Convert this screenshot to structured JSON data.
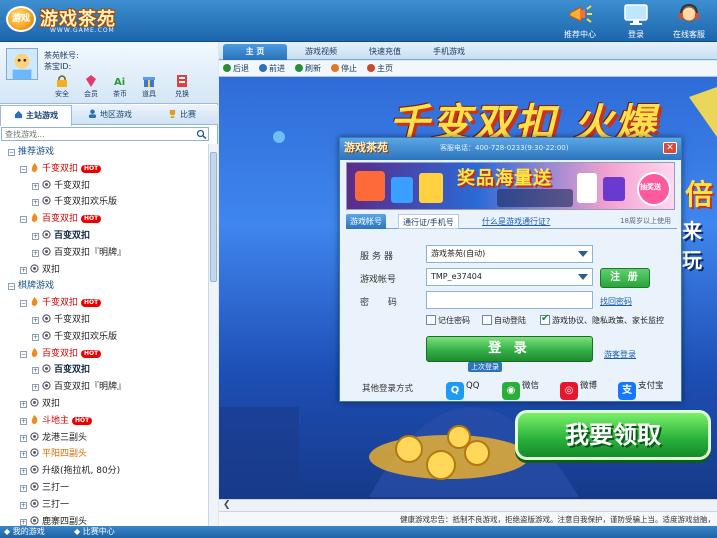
{
  "app": {
    "logo_badge": "游戏",
    "logo_text": "游戏茶苑",
    "logo_url": "WWW.GAME.COM",
    "top_nav": [
      {
        "label": "推荐中心",
        "icon": "megaphone-icon"
      },
      {
        "label": "登录",
        "icon": "monitor-icon"
      },
      {
        "label": "在线客服",
        "icon": "headset-icon"
      }
    ]
  },
  "user": {
    "account_label": "茶苑帐号:",
    "id_label": "茶宝ID:",
    "quick_actions": [
      {
        "label": "安全",
        "icon": "lock-icon"
      },
      {
        "label": "会员",
        "icon": "diamond-icon"
      },
      {
        "label": "茶币",
        "icon": "coin-icon"
      },
      {
        "label": "道具",
        "icon": "gift-icon"
      },
      {
        "label": "兑换",
        "icon": "exchange-icon"
      }
    ]
  },
  "left_tabs": [
    {
      "label": "主站游戏",
      "icon": "home-icon"
    },
    {
      "label": "地区游戏",
      "icon": "people-icon"
    },
    {
      "label": "比赛",
      "icon": "trophy-icon"
    }
  ],
  "search": {
    "placeholder": "查找游戏..."
  },
  "tree": [
    {
      "level": 0,
      "exp": "⊟",
      "text": "推荐游戏",
      "style": "blue",
      "icon": "none"
    },
    {
      "level": 1,
      "exp": "⊟",
      "text": "千变双扣",
      "style": "red",
      "icon": "fire-icon",
      "hot": "HOT"
    },
    {
      "level": 2,
      "exp": "⊞",
      "text": "千变双扣",
      "style": "",
      "icon": "game-icon"
    },
    {
      "level": 2,
      "exp": "⊞",
      "text": "千变双扣欢乐版",
      "style": "",
      "icon": "game-icon"
    },
    {
      "level": 1,
      "exp": "⊟",
      "text": "百变双扣",
      "style": "red",
      "icon": "fire-icon",
      "hot": "HOT"
    },
    {
      "level": 2,
      "exp": "⊞",
      "text": "百变双扣",
      "style": "bold",
      "icon": "game-icon"
    },
    {
      "level": 2,
      "exp": "⊞",
      "text": "百变双扣『明牌』",
      "style": "",
      "icon": "game-icon"
    },
    {
      "level": 1,
      "exp": "⊞",
      "text": "双扣",
      "style": "",
      "icon": "game-icon"
    },
    {
      "level": 0,
      "exp": "⊟",
      "text": "棋牌游戏",
      "style": "blue",
      "icon": "none"
    },
    {
      "level": 1,
      "exp": "⊟",
      "text": "千变双扣",
      "style": "red",
      "icon": "fire-icon",
      "hot": "HOT"
    },
    {
      "level": 2,
      "exp": "⊞",
      "text": "千变双扣",
      "style": "",
      "icon": "game-icon"
    },
    {
      "level": 2,
      "exp": "⊞",
      "text": "千变双扣欢乐版",
      "style": "",
      "icon": "game-icon"
    },
    {
      "level": 1,
      "exp": "⊟",
      "text": "百变双扣",
      "style": "red",
      "icon": "fire-icon",
      "hot": "HOT"
    },
    {
      "level": 2,
      "exp": "⊞",
      "text": "百变双扣",
      "style": "bold",
      "icon": "game-icon"
    },
    {
      "level": 2,
      "exp": "⊞",
      "text": "百变双扣『明牌』",
      "style": "",
      "icon": "game-icon"
    },
    {
      "level": 1,
      "exp": "⊞",
      "text": "双扣",
      "style": "",
      "icon": "game-icon"
    },
    {
      "level": 1,
      "exp": "⊞",
      "text": "斗地主",
      "style": "red",
      "icon": "fire-icon",
      "hot": "HOT"
    },
    {
      "level": 1,
      "exp": "⊞",
      "text": "龙港三副头",
      "style": "",
      "icon": "game-icon"
    },
    {
      "level": 1,
      "exp": "⊞",
      "text": "平阳四副头",
      "style": "orange",
      "icon": "game-icon"
    },
    {
      "level": 1,
      "exp": "⊞",
      "text": "升级(拖拉机, 80分)",
      "style": "",
      "icon": "game-icon"
    },
    {
      "level": 1,
      "exp": "⊞",
      "text": "三打一",
      "style": "",
      "icon": "game-icon"
    },
    {
      "level": 1,
      "exp": "⊞",
      "text": "三打一",
      "style": "",
      "icon": "game-icon"
    },
    {
      "level": 1,
      "exp": "⊞",
      "text": "鹿寨四副头",
      "style": "",
      "icon": "game-icon"
    }
  ],
  "bottom_tabs": [
    "我的游戏",
    "比赛中心"
  ],
  "right_tabs": [
    "主 页",
    "游戏视频",
    "快速充值",
    "手机游戏"
  ],
  "nav_buttons": [
    {
      "label": "后退",
      "icon": "back-icon",
      "color": "#2e8b3a"
    },
    {
      "label": "前进",
      "icon": "forward-icon",
      "color": "#2e6fc0"
    },
    {
      "label": "刷新",
      "icon": "refresh-icon",
      "color": "#2e8b3a"
    },
    {
      "label": "停止",
      "icon": "stop-icon",
      "color": "#e07820"
    },
    {
      "label": "主页",
      "icon": "home-icon",
      "color": "#c84a2a"
    }
  ],
  "promo": {
    "headline": "千变双扣 火爆",
    "side_char": "倍",
    "side_text": "来玩",
    "claim_button": "我要领取"
  },
  "footer_notice": "健康游戏忠告：抵制不良游戏，拒绝盗版游戏。注意自我保护，谨防受骗上当。适度游戏益脑，",
  "dialog": {
    "logo": "游戏茶苑",
    "phone": "客服电话：400-728-0233(9:30-22:00)",
    "banner_title": "奖品海量送",
    "banner_badge": "抽奖送",
    "tabs": [
      "游戏帐号",
      "通行证/手机号"
    ],
    "what_is_link": "什么是游戏通行证?",
    "age_note": "18周岁以上使用",
    "server_label": "服务器",
    "server_value": "游戏茶苑(自动)",
    "account_label": "游戏帐号",
    "account_value": "TMP_e37404",
    "password_label": "密 码",
    "register_button": "注 册",
    "forgot_link": "找回密码",
    "remember_password": "记住密码",
    "auto_login": "自动登陆",
    "agreement": "游戏协议、隐私政策、家长监控",
    "login_button": "登 录",
    "guest_link": "游客登录",
    "last_login": "上次登录",
    "other_login_label": "其他登录方式",
    "social": [
      {
        "label": "QQ",
        "icon": "qq-icon",
        "color": "#1d9bf0"
      },
      {
        "label": "微信",
        "icon": "wechat-icon",
        "color": "#2aae3a"
      },
      {
        "label": "微博",
        "icon": "weibo-icon",
        "color": "#e6162d"
      },
      {
        "label": "支付宝",
        "icon": "alipay-icon",
        "color": "#1677ff"
      }
    ]
  }
}
